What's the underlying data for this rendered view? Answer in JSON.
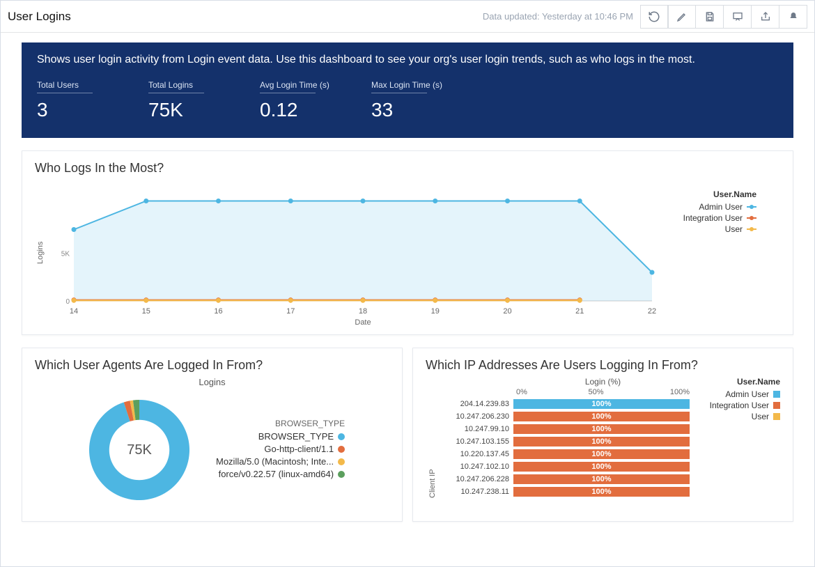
{
  "header": {
    "title": "User Logins",
    "updated": "Data updated: Yesterday at 10:46 PM",
    "icons": [
      "undo",
      "edit",
      "save",
      "present",
      "share",
      "notification"
    ]
  },
  "intro": "Shows user login activity from Login event data. Use this dashboard to see your org's user login trends, such as who logs in the most.",
  "metrics": [
    {
      "label": "Total Users",
      "value": "3"
    },
    {
      "label": "Total Logins",
      "value": "75K"
    },
    {
      "label": "Avg Login Time (s)",
      "value": "0.12"
    },
    {
      "label": "Max Login Time (s)",
      "value": "33"
    }
  ],
  "colors": {
    "admin": "#4db6e2",
    "integration": "#e26d3e",
    "user": "#f3b94a",
    "goHttp": "#e26d3e",
    "mozilla": "#f3b94a",
    "force": "#5c9f5e",
    "browser": "#4db6e2"
  },
  "lineChart": {
    "title": "Who Logs In the Most?",
    "xlabel": "Date",
    "ylabel": "Logins",
    "legend_title": "User.Name"
  },
  "uaChart": {
    "title": "Which User Agents Are Logged In From?",
    "center_label": "75K",
    "measure": "Logins",
    "legend_title": "BROWSER_TYPE"
  },
  "ipChart": {
    "title": "Which IP Addresses Are Users Logging In From?",
    "measure": "Login (%)",
    "ylabel": "Client IP",
    "legend_title": "User.Name",
    "scale": [
      "0%",
      "50%",
      "100%"
    ]
  },
  "chart_data": [
    {
      "id": "who_logs_in",
      "type": "line",
      "title": "Who Logs In the Most?",
      "xlabel": "Date",
      "ylabel": "Logins",
      "x": [
        14,
        15,
        16,
        17,
        18,
        19,
        20,
        21,
        22
      ],
      "yticks": [
        0,
        5000
      ],
      "ytick_labels": [
        "0",
        "5K"
      ],
      "ylim": [
        0,
        12000
      ],
      "series": [
        {
          "name": "Admin User",
          "color": "#4db6e2",
          "values": [
            7500,
            10500,
            10500,
            10500,
            10500,
            10500,
            10500,
            10500,
            3000
          ]
        },
        {
          "name": "Integration User",
          "color": "#e26d3e",
          "values": [
            100,
            100,
            100,
            100,
            100,
            100,
            100,
            100,
            null
          ]
        },
        {
          "name": "User",
          "color": "#f3b94a",
          "values": [
            50,
            50,
            50,
            50,
            50,
            50,
            50,
            50,
            null
          ]
        }
      ],
      "legend_title": "User.Name"
    },
    {
      "id": "user_agents",
      "type": "donut",
      "title": "Which User Agents Are Logged In From?",
      "total_label": "75K",
      "measure": "Logins",
      "legend_title": "BROWSER_TYPE",
      "slices": [
        {
          "name": "BROWSER_TYPE",
          "color": "#4db6e2",
          "value": 95
        },
        {
          "name": "Go-http-client/1.1",
          "color": "#e26d3e",
          "value": 2
        },
        {
          "name": "Mozilla/5.0 (Macintosh; Inte...",
          "color": "#f3b94a",
          "value": 1
        },
        {
          "name": "force/v0.22.57 (linux-amd64)",
          "color": "#5c9f5e",
          "value": 2
        }
      ]
    },
    {
      "id": "ip_addresses",
      "type": "stacked_bar_horizontal",
      "title": "Which IP Addresses Are Users Logging In From?",
      "xlabel": "Login (%)",
      "ylabel": "Client IP",
      "xlim": [
        0,
        100
      ],
      "xticks": [
        "0%",
        "50%",
        "100%"
      ],
      "legend_title": "User.Name",
      "series_names": [
        "Admin User",
        "Integration User",
        "User"
      ],
      "series_colors": [
        "#4db6e2",
        "#e26d3e",
        "#f3b94a"
      ],
      "rows": [
        {
          "ip": "204.14.239.83",
          "label": "100%",
          "segments": [
            100,
            0,
            0
          ]
        },
        {
          "ip": "10.247.206.230",
          "label": "100%",
          "segments": [
            0,
            100,
            0
          ]
        },
        {
          "ip": "10.247.99.10",
          "label": "100%",
          "segments": [
            0,
            100,
            0
          ]
        },
        {
          "ip": "10.247.103.155",
          "label": "100%",
          "segments": [
            0,
            100,
            0
          ]
        },
        {
          "ip": "10.220.137.45",
          "label": "100%",
          "segments": [
            0,
            100,
            0
          ]
        },
        {
          "ip": "10.247.102.10",
          "label": "100%",
          "segments": [
            0,
            100,
            0
          ]
        },
        {
          "ip": "10.247.206.228",
          "label": "100%",
          "segments": [
            0,
            100,
            0
          ]
        },
        {
          "ip": "10.247.238.11",
          "label": "100%",
          "segments": [
            0,
            100,
            0
          ]
        }
      ]
    }
  ]
}
